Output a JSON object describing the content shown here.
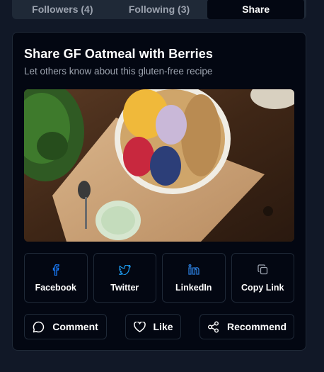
{
  "tabs": [
    {
      "label": "Followers (4)"
    },
    {
      "label": "Following (3)"
    },
    {
      "label": "Share",
      "active": true
    }
  ],
  "share_card": {
    "title": "Share GF Oatmeal with Berries",
    "subtitle": "Let others know about this gluten-free recipe"
  },
  "share_buttons": [
    {
      "label": "Facebook",
      "icon": "facebook-icon",
      "color": "#1877f2"
    },
    {
      "label": "Twitter",
      "icon": "twitter-icon",
      "color": "#1d9bf0"
    },
    {
      "label": "LinkedIn",
      "icon": "linkedin-icon",
      "color": "#0a66c2"
    },
    {
      "label": "Copy Link",
      "icon": "copy-icon",
      "color": "#9ca3af"
    }
  ],
  "actions": [
    {
      "label": "Comment",
      "icon": "comment-icon"
    },
    {
      "label": "Like",
      "icon": "heart-icon"
    },
    {
      "label": "Recommend",
      "icon": "share-nodes-icon"
    }
  ]
}
